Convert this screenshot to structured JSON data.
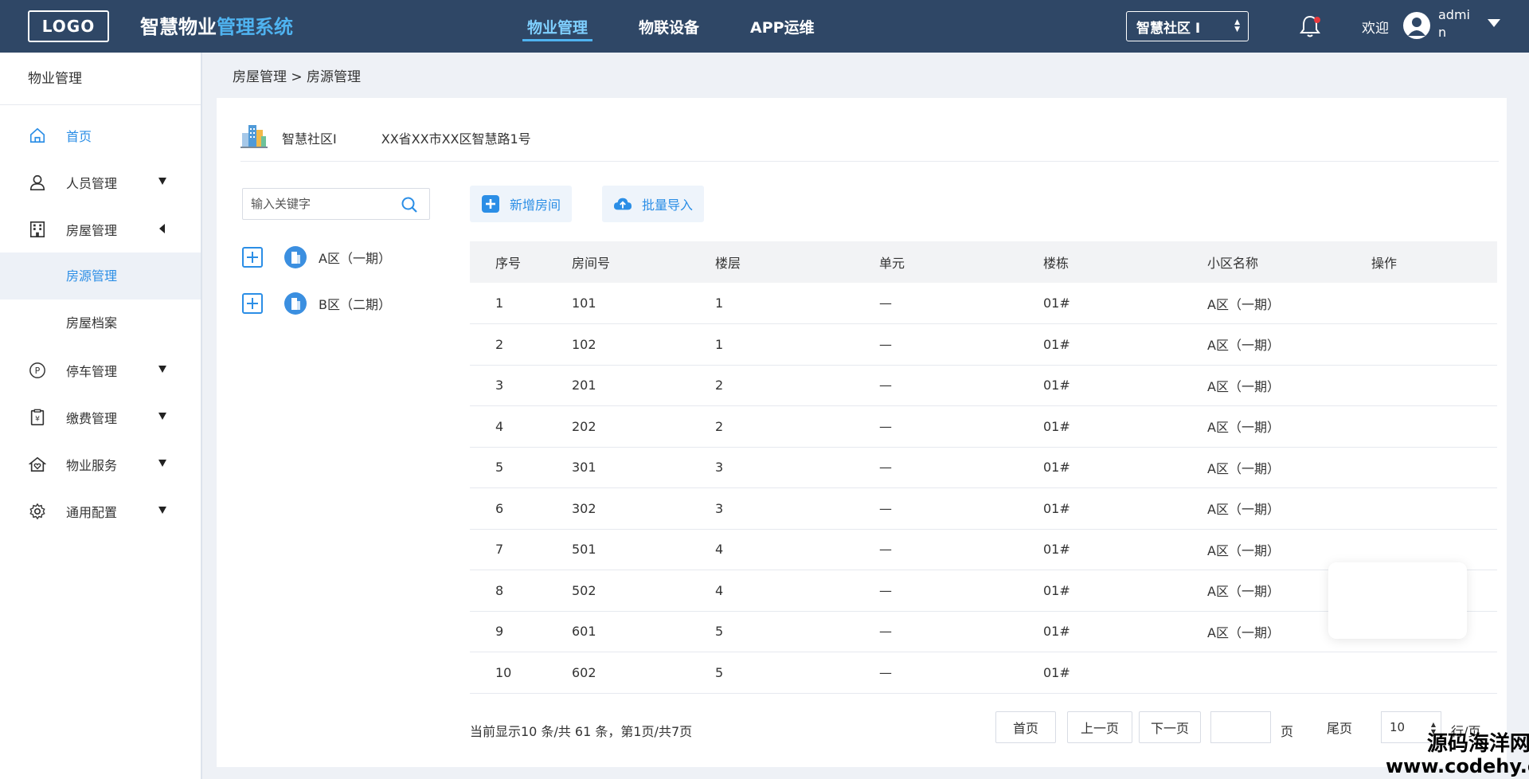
{
  "header": {
    "logo": "LOGO",
    "title_part1": "智慧物业",
    "title_part2": "管理系统",
    "nav": [
      {
        "label": "物业管理",
        "active": true
      },
      {
        "label": "物联设备",
        "active": false
      },
      {
        "label": "APP运维",
        "active": false
      }
    ],
    "community_select": "智慧社区 I",
    "welcome": "欢迎",
    "username": "admin",
    "accent_color": "#4fb3f0",
    "bg_color": "#2f4766"
  },
  "sidebar": {
    "title": "物业管理",
    "items": [
      {
        "label": "首页",
        "icon": "home-icon"
      },
      {
        "label": "人员管理",
        "icon": "user-icon"
      },
      {
        "label": "房屋管理",
        "icon": "building-icon"
      },
      {
        "label": "房源管理"
      },
      {
        "label": "房屋档案"
      },
      {
        "label": "停车管理",
        "icon": "parking-icon"
      },
      {
        "label": "缴费管理",
        "icon": "payment-icon"
      },
      {
        "label": "物业服务",
        "icon": "service-icon"
      },
      {
        "label": "通用配置",
        "icon": "gear-icon"
      }
    ]
  },
  "breadcrumb": "房屋管理 > 房源管理",
  "community": {
    "name": "智慧社区I",
    "address": "XX省XX市XX区智慧路1号"
  },
  "search": {
    "placeholder": "输入关键字"
  },
  "tree": [
    {
      "label": "A区（一期）"
    },
    {
      "label": "B区（二期）"
    }
  ],
  "actions": {
    "add_room": "新增房间",
    "batch_import": "批量导入"
  },
  "table": {
    "headers": [
      "序号",
      "房间号",
      "楼层",
      "单元",
      "楼栋",
      "小区名称",
      "操作"
    ],
    "rows": [
      [
        "1",
        "101",
        "1",
        "—",
        "01#",
        "A区（一期）",
        ""
      ],
      [
        "2",
        "102",
        "1",
        "—",
        "01#",
        "A区（一期）",
        ""
      ],
      [
        "3",
        "201",
        "2",
        "—",
        "01#",
        "A区（一期）",
        ""
      ],
      [
        "4",
        "202",
        "2",
        "—",
        "01#",
        "A区（一期）",
        ""
      ],
      [
        "5",
        "301",
        "3",
        "—",
        "01#",
        "A区（一期）",
        ""
      ],
      [
        "6",
        "302",
        "3",
        "—",
        "01#",
        "A区（一期）",
        ""
      ],
      [
        "7",
        "501",
        "4",
        "—",
        "01#",
        "A区（一期）",
        ""
      ],
      [
        "8",
        "502",
        "4",
        "—",
        "01#",
        "A区（一期）",
        ""
      ],
      [
        "9",
        "601",
        "5",
        "—",
        "01#",
        "A区（一期）",
        ""
      ],
      [
        "10",
        "602",
        "5",
        "—",
        "01#",
        "",
        ""
      ]
    ]
  },
  "pagination": {
    "info": "当前显示10 条/共 61 条，第1页/共7页",
    "first": "首页",
    "prev": "上一页",
    "next": "下一页",
    "page_unit": "页",
    "last": "尾页",
    "rows_value": "10",
    "rows_unit": "行/页"
  },
  "watermark": {
    "line1": "源码海洋网",
    "line2": "www.codehy.com"
  }
}
